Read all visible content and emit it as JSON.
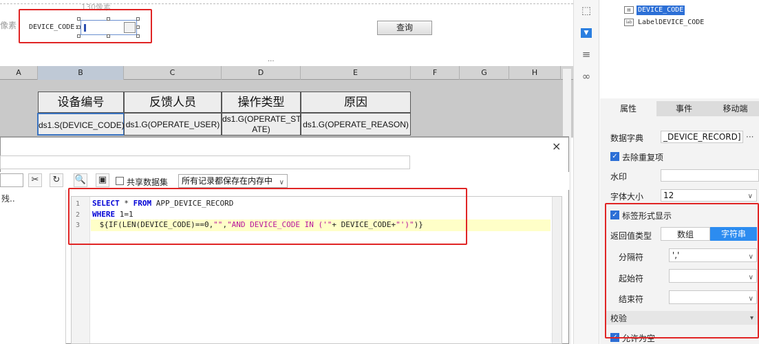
{
  "param_panel": {
    "ruler_label": "130像素",
    "left_px_label": "像素",
    "device_code_label": "DEVICE_CODE:",
    "query_button": "查询",
    "collapse_dots": "..."
  },
  "sheet": {
    "columns": [
      "A",
      "B",
      "C",
      "D",
      "E",
      "F",
      "G",
      "H"
    ],
    "headers": [
      "设备编号",
      "反馈人员",
      "操作类型",
      "原因"
    ],
    "data_cells": [
      "ds1.S(DEVICE_CODE)",
      "ds1.G(OPERATE_USER)",
      "ds1.G(OPERATE_ST ATE)",
      "ds1.G(OPERATE_REASON)"
    ]
  },
  "dialog": {
    "close_icon": "×",
    "share_dataset_label": "共享数据集",
    "memory_option": "所有记录都保存在内存中",
    "left_pane_text": "残..",
    "line_numbers": [
      "1",
      "2",
      "3"
    ],
    "code": {
      "line1_kw1": "SELECT",
      "line1_rest": " * ",
      "line1_kw2": "FROM",
      "line1_table": " APP_DEVICE_RECORD",
      "line2_kw": "WHERE",
      "line2_rest": " 1=1",
      "line3_a": " ${IF(LEN(DEVICE_CODE)==0,",
      "line3_b": "\"\"",
      "line3_c": ",",
      "line3_d": "\"AND DEVICE_CODE IN ('\"",
      "line3_e": "+ DEVICE_CODE+",
      "line3_f": "\"')\"",
      "line3_g": ")}"
    }
  },
  "right_panel": {
    "tree_selected": "DEVICE_CODE",
    "tree_label_item": "LabelDEVICE_CODE",
    "tabs": [
      "属性",
      "事件",
      "移动端"
    ],
    "data_dict_label": "数据字典",
    "data_dict_value": "_DEVICE_RECORD]",
    "data_dict_btn": "···",
    "remove_dup_label": "去除重复项",
    "watermark_label": "水印",
    "font_size_label": "字体大小",
    "font_size_value": "12",
    "tag_display_label": "标签形式显示",
    "return_type_label": "返回值类型",
    "return_type_array": "数组",
    "return_type_string": "字符串",
    "separator_label": "分隔符",
    "separator_value": "','",
    "start_char_label": "起始符",
    "end_char_label": "结束符",
    "verify_label": "校验",
    "allow_empty_label": "允许为空"
  },
  "colors": {
    "highlight_red": "#e02424",
    "selection_blue": "#2c6fd6",
    "segment_active": "#2c8cf0"
  }
}
